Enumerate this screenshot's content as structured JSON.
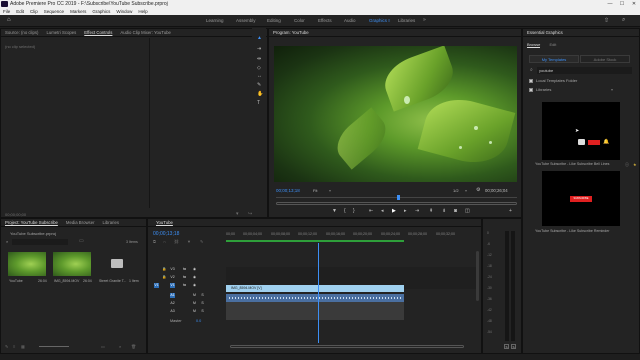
{
  "window": {
    "title": "Adobe Premiere Pro CC 2019 - F:\\Subscribe\\YouTube Subscribe.prproj",
    "min": "—",
    "max": "☐",
    "close": "✕"
  },
  "menu": [
    "File",
    "Edit",
    "Clip",
    "Sequence",
    "Markers",
    "Graphics",
    "Window",
    "Help"
  ],
  "workspaces": [
    "Learning",
    "Assembly",
    "Editing",
    "Color",
    "Effects",
    "Audio",
    "Graphics",
    "Libraries"
  ],
  "active_workspace": "Graphics",
  "source_panel": {
    "tabs": [
      "Source: (no clips)",
      "Lumetri Scopes",
      "Effect Controls",
      "Audio Clip Mixer: YouTube"
    ],
    "active_tab": "Effect Controls",
    "no_clip_text": "(no clip selected)",
    "bottom_left_time": "00;00;00;00"
  },
  "program": {
    "title": "Program: YouTube",
    "timecode": "00;00;13;18",
    "fit": "Fit",
    "quality": "1/2",
    "duration": "00;00;26;04"
  },
  "essential_graphics": {
    "title": "Essential Graphics",
    "tabs": [
      "Browse",
      "Edit"
    ],
    "active_tab": "Browse",
    "sub_tabs": [
      "My Templates",
      "Adobe Stock"
    ],
    "active_sub_tab": "My Templates",
    "search_value": "youtube",
    "local_folder": "Local Templates Folder",
    "libraries": "Libraries",
    "template1_label": "YouTube Subscribe - Like Subscribe Bell Lines",
    "template2_label": "YouTube Subscribe - Like Subscribe Reminder",
    "template2_button": "SUBSCRIBE"
  },
  "project_panel": {
    "tabs": [
      "Project: YouTube Subscribe",
      "Media Browser",
      "Libraries"
    ],
    "active_tab": "Project: YouTube Subscribe",
    "file": "YouTube Subscribe.prproj",
    "items_count": "3 Items",
    "items": [
      {
        "name": "YouTube",
        "duration": "26:04"
      },
      {
        "name": "IMG_8594.MOV",
        "duration": "26:04"
      },
      {
        "name": "Street Granite T...",
        "duration": "1 Item"
      }
    ]
  },
  "timeline": {
    "sequence_tab": "YouTube",
    "timecode": "00;00;13;18",
    "ruler": [
      "00;00",
      "00;00;04;00",
      "00;00;08;00",
      "00;00;12;00",
      "00;00;16;00",
      "00;00;20;00",
      "00;00;24;00",
      "00;00;28;00",
      "00;00;32;00",
      "00;00;36;00"
    ],
    "video_tracks": [
      "V3",
      "V2",
      "V1"
    ],
    "audio_tracks": [
      "A1",
      "A2",
      "A3"
    ],
    "master_label": "Master",
    "master_value": "0.0",
    "clip_v1": "IMG_8594.MOV [V]",
    "source_patch": "V1"
  },
  "audio_meter": {
    "ticks": [
      "0",
      "-6",
      "-12",
      "-18",
      "-24",
      "-30",
      "-36",
      "-42",
      "-48",
      "-54"
    ],
    "solo": "S",
    "solo2": "S"
  },
  "tools": [
    "selection",
    "track-select",
    "ripple",
    "razor",
    "slip",
    "pen",
    "hand",
    "type"
  ],
  "transport": [
    "marker",
    "in",
    "out",
    "go-in",
    "step-back",
    "play",
    "step-fwd",
    "go-out",
    "lift",
    "extract",
    "export-frame",
    "compare",
    "add"
  ]
}
